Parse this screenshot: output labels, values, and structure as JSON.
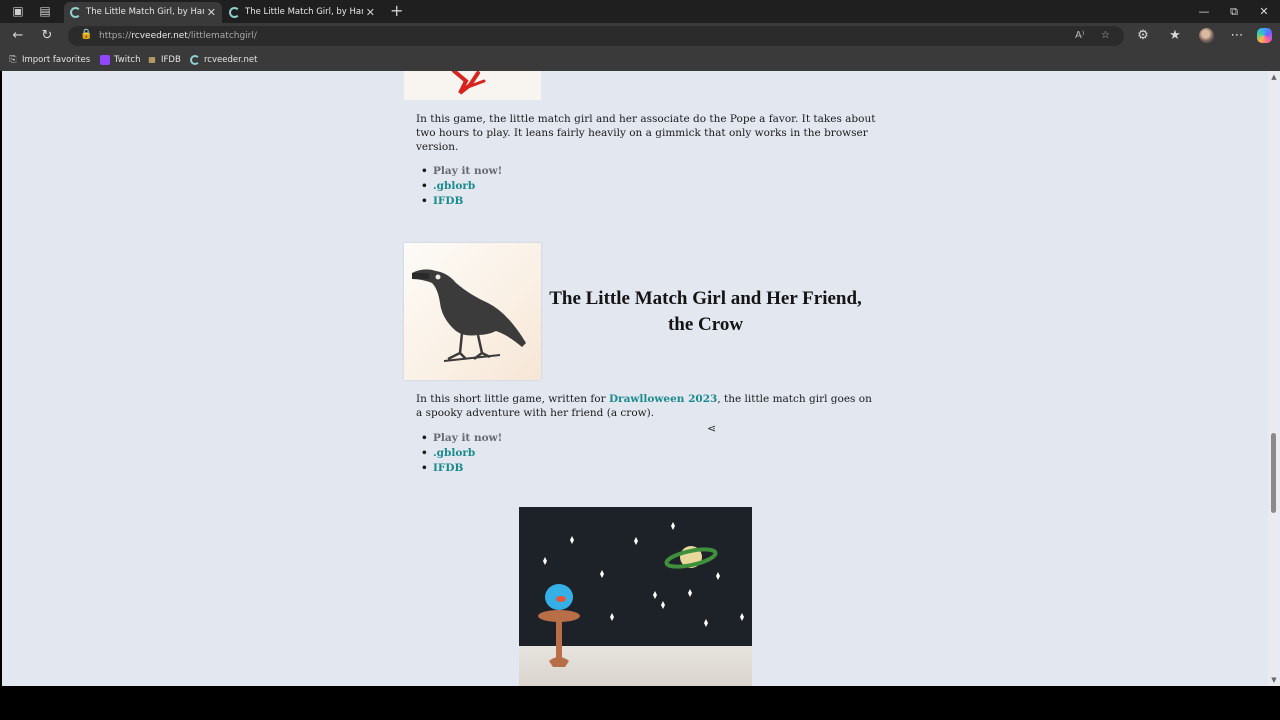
{
  "browser": {
    "tabs": [
      {
        "title": "The Little Match Girl, by Hans Ch",
        "active": true
      },
      {
        "title": "The Little Match Girl, by Hans Ch",
        "active": false
      }
    ],
    "new_tab_icon": "plus-icon",
    "url_prefix": "https://",
    "url_host": "rcveeder.net",
    "url_path": "/littlematchgirl/",
    "favorites": [
      {
        "label": "Import favorites",
        "icon": "import-icon"
      },
      {
        "label": "Twitch",
        "icon": "twitch-icon"
      },
      {
        "label": "IFDB",
        "icon": "ifdb-icon"
      },
      {
        "label": "rcveeder.net",
        "icon": "site-icon"
      }
    ],
    "read_aloud_glyph": "A⁾"
  },
  "page": {
    "game1": {
      "description": "In this game, the little match girl and her associate do the Pope a favor. It takes about two hours to play. It leans fairly heavily on a gimmick that only works in the browser version.",
      "links": {
        "play": "Play it now!",
        "gblorb": ".gblorb",
        "ifdb": "IFDB"
      }
    },
    "game2": {
      "title": "The Little Match Girl and Her Friend, the Crow",
      "description_before": "In this short little game, written for ",
      "description_link": "Drawlloween 2023",
      "description_after": ", the little match girl goes on a spooky adventure with her friend (a crow).",
      "links": {
        "play": "Play it now!",
        "gblorb": ".gblorb",
        "ifdb": "IFDB"
      }
    }
  },
  "colors": {
    "page_bg": "#e3e7f0",
    "link": "#1a8a8a",
    "muted_link": "#666a6e",
    "chrome_dark": "#1f1f1f",
    "chrome": "#3a3a3a"
  }
}
